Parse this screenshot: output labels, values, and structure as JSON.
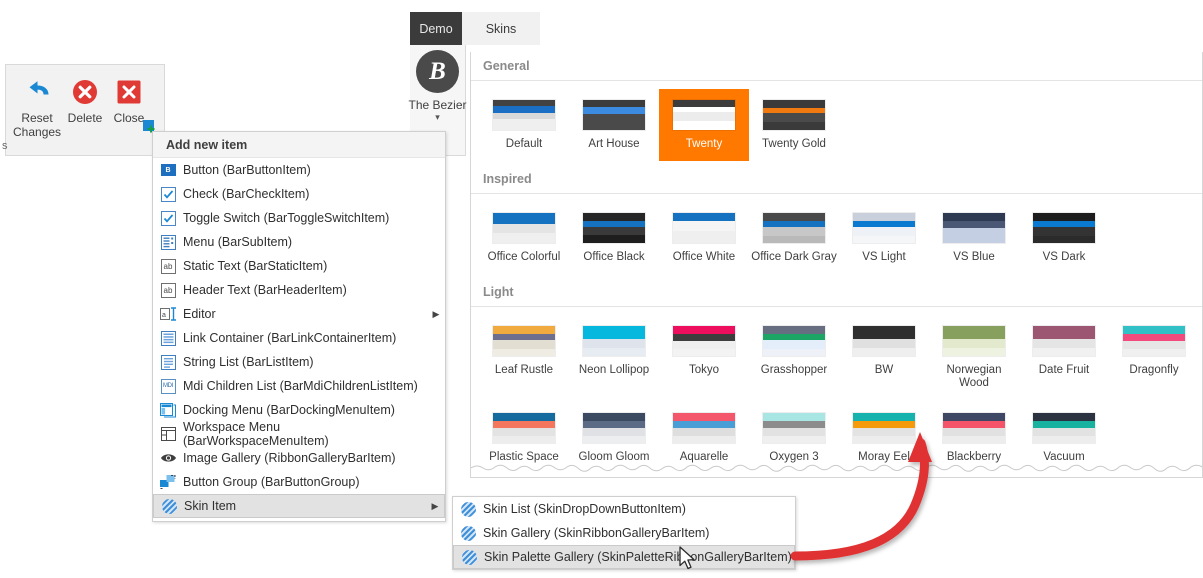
{
  "ribbon": {
    "tabs": [
      {
        "label": "Demo",
        "active": false
      },
      {
        "label": "Skins",
        "active": true
      }
    ],
    "group": {
      "icon": "bezier-circle-icon",
      "glyph": "B",
      "label": "The Bezier",
      "caret": "▾"
    }
  },
  "gallery": {
    "groups": [
      {
        "title": "General",
        "items": [
          {
            "name": "Default",
            "selected": false,
            "bands": [
              {
                "c": "#424242",
                "h": 6
              },
              {
                "c": "#1a6fc4",
                "h": 7
              },
              {
                "c": "#d9d9d9",
                "h": 6
              },
              {
                "c": "#efefef",
                "h": 11
              }
            ]
          },
          {
            "name": "Art House",
            "selected": false,
            "bands": [
              {
                "c": "#3c3c3c",
                "h": 7
              },
              {
                "c": "#3b8ce0",
                "h": 7
              },
              {
                "c": "#4a4a4a",
                "h": 9
              },
              {
                "c": "#4a4a4a",
                "h": 7
              }
            ]
          },
          {
            "name": "Twenty",
            "selected": true,
            "bands": [
              {
                "c": "#3c3c3c",
                "h": 7
              },
              {
                "c": "#ffffff",
                "h": 5
              },
              {
                "c": "#ececec",
                "h": 9
              },
              {
                "c": "#ffffff",
                "h": 9
              }
            ]
          },
          {
            "name": "Twenty Gold",
            "selected": false,
            "bands": [
              {
                "c": "#3a3a3a",
                "h": 8
              },
              {
                "c": "#f07a10",
                "h": 5
              },
              {
                "c": "#4a4a4a",
                "h": 9
              },
              {
                "c": "#3a3a3a",
                "h": 8
              }
            ]
          }
        ]
      },
      {
        "title": "Inspired",
        "items": [
          {
            "name": "Office Colorful",
            "selected": false,
            "bands": [
              {
                "c": "#1572c0",
                "h": 11
              },
              {
                "c": "#e4e4e4",
                "h": 9
              },
              {
                "c": "#efefef",
                "h": 10
              }
            ]
          },
          {
            "name": "Office Black",
            "selected": false,
            "bands": [
              {
                "c": "#262626",
                "h": 8
              },
              {
                "c": "#1572c0",
                "h": 6
              },
              {
                "c": "#3a3a3a",
                "h": 8
              },
              {
                "c": "#1e1e1e",
                "h": 8
              }
            ]
          },
          {
            "name": "Office White",
            "selected": false,
            "bands": [
              {
                "c": "#1572c0",
                "h": 8
              },
              {
                "c": "#f5f5f5",
                "h": 10
              },
              {
                "c": "#efefef",
                "h": 12
              }
            ]
          },
          {
            "name": "Office Dark Gray",
            "selected": false,
            "bands": [
              {
                "c": "#4a4a4a",
                "h": 8
              },
              {
                "c": "#1572c0",
                "h": 6
              },
              {
                "c": "#c7c7c7",
                "h": 9
              },
              {
                "c": "#b9b9b9",
                "h": 7
              }
            ]
          },
          {
            "name": "VS Light",
            "selected": false,
            "bands": [
              {
                "c": "#c9d0dc",
                "h": 8
              },
              {
                "c": "#0a7ad0",
                "h": 6
              },
              {
                "c": "#eef1f5",
                "h": 9
              },
              {
                "c": "#f4f6f8",
                "h": 7
              }
            ]
          },
          {
            "name": "VS Blue",
            "selected": false,
            "bands": [
              {
                "c": "#2e3a52",
                "h": 8
              },
              {
                "c": "#4a5875",
                "h": 7
              },
              {
                "c": "#c5cfe3",
                "h": 9
              },
              {
                "c": "#c5cfe3",
                "h": 6
              }
            ]
          },
          {
            "name": "VS Dark",
            "selected": false,
            "bands": [
              {
                "c": "#1d1d1d",
                "h": 8
              },
              {
                "c": "#0a7ad0",
                "h": 6
              },
              {
                "c": "#333333",
                "h": 9
              },
              {
                "c": "#2b2b2b",
                "h": 7
              }
            ]
          }
        ]
      },
      {
        "title": "Light",
        "items": [
          {
            "name": "Leaf Rustle",
            "selected": false,
            "bands": [
              {
                "c": "#f0aa3e",
                "h": 8
              },
              {
                "c": "#6e6f8e",
                "h": 6
              },
              {
                "c": "#e3ded2",
                "h": 9
              },
              {
                "c": "#efece4",
                "h": 7
              }
            ]
          },
          {
            "name": "Neon Lollipop",
            "selected": false,
            "bands": [
              {
                "c": "#07b8de",
                "h": 13
              },
              {
                "c": "#dfe3ec",
                "h": 9
              },
              {
                "c": "#e7ebf2",
                "h": 8
              }
            ]
          },
          {
            "name": "Tokyo",
            "selected": false,
            "bands": [
              {
                "c": "#ed0f5d",
                "h": 8
              },
              {
                "c": "#3d3d3d",
                "h": 7
              },
              {
                "c": "#efefef",
                "h": 8
              },
              {
                "c": "#f3f3f3",
                "h": 7
              }
            ]
          },
          {
            "name": "Grasshopper",
            "selected": false,
            "bands": [
              {
                "c": "#686e82",
                "h": 8
              },
              {
                "c": "#1da565",
                "h": 6
              },
              {
                "c": "#e4edfa",
                "h": 9
              },
              {
                "c": "#eef2f8",
                "h": 7
              }
            ]
          },
          {
            "name": "BW",
            "selected": false,
            "bands": [
              {
                "c": "#2f2f2f",
                "h": 13
              },
              {
                "c": "#e0e0e0",
                "h": 9
              },
              {
                "c": "#efefef",
                "h": 8
              }
            ]
          },
          {
            "name": "Norwegian Wood",
            "selected": false,
            "bands": [
              {
                "c": "#87a05e",
                "h": 13
              },
              {
                "c": "#e3e9cd",
                "h": 9
              },
              {
                "c": "#eef2e0",
                "h": 8
              }
            ]
          },
          {
            "name": "Date Fruit",
            "selected": false,
            "bands": [
              {
                "c": "#9d5672",
                "h": 13
              },
              {
                "c": "#e5e5e5",
                "h": 9
              },
              {
                "c": "#f1f1f1",
                "h": 8
              }
            ]
          },
          {
            "name": "Dragonfly",
            "selected": false,
            "bands": [
              {
                "c": "#31c0c6",
                "h": 8
              },
              {
                "c": "#f34a7d",
                "h": 7
              },
              {
                "c": "#e6e6e6",
                "h": 8
              },
              {
                "c": "#f0f0f0",
                "h": 7
              }
            ]
          },
          {
            "name": "Plastic Space",
            "selected": false,
            "bands": [
              {
                "c": "#156a9e",
                "h": 8
              },
              {
                "c": "#f4775d",
                "h": 7
              },
              {
                "c": "#e3e3e3",
                "h": 8
              },
              {
                "c": "#ededed",
                "h": 7
              }
            ]
          },
          {
            "name": "Gloom Gloom",
            "selected": false,
            "bands": [
              {
                "c": "#3b4a60",
                "h": 8
              },
              {
                "c": "#5b6a85",
                "h": 7
              },
              {
                "c": "#dfe1e5",
                "h": 8
              },
              {
                "c": "#eceef0",
                "h": 7
              }
            ]
          },
          {
            "name": "Aquarelle",
            "selected": false,
            "bands": [
              {
                "c": "#f4566b",
                "h": 8
              },
              {
                "c": "#4a9ed6",
                "h": 7
              },
              {
                "c": "#dedede",
                "h": 8
              },
              {
                "c": "#ededed",
                "h": 7
              }
            ]
          },
          {
            "name": "Oxygen 3",
            "selected": false,
            "bands": [
              {
                "c": "#a7e6e2",
                "h": 8
              },
              {
                "c": "#8c8c8c",
                "h": 7
              },
              {
                "c": "#e2e2e2",
                "h": 8
              },
              {
                "c": "#efefef",
                "h": 7
              }
            ]
          },
          {
            "name": "Moray Eel",
            "selected": false,
            "bands": [
              {
                "c": "#16b2ad",
                "h": 8
              },
              {
                "c": "#f59a0a",
                "h": 7
              },
              {
                "c": "#e3e3e3",
                "h": 8
              },
              {
                "c": "#ededed",
                "h": 7
              }
            ]
          },
          {
            "name": "Blackberry",
            "selected": false,
            "bands": [
              {
                "c": "#3e4763",
                "h": 8
              },
              {
                "c": "#f4536a",
                "h": 7
              },
              {
                "c": "#e1e1e1",
                "h": 8
              },
              {
                "c": "#ededed",
                "h": 7
              }
            ]
          },
          {
            "name": "Vacuum",
            "selected": false,
            "bands": [
              {
                "c": "#2c3340",
                "h": 8
              },
              {
                "c": "#18b3a0",
                "h": 7
              },
              {
                "c": "#e2e2e2",
                "h": 8
              },
              {
                "c": "#ededed",
                "h": 7
              }
            ]
          }
        ]
      }
    ]
  },
  "mini_toolbar": {
    "buttons": [
      {
        "label": "Reset Changes",
        "icon": "undo-arrow-icon"
      },
      {
        "label": "Delete",
        "icon": "delete-circle-x-icon"
      },
      {
        "label": "Close",
        "icon": "close-square-x-icon"
      }
    ],
    "edge_text": "s",
    "badge_icon": "add-item-badge-icon"
  },
  "add_menu": {
    "title": "Add new item",
    "items": [
      {
        "label": "Button (BarButtonItem)",
        "icon": "button-icon",
        "arrow": false,
        "highlight": false
      },
      {
        "label": "Check (BarCheckItem)",
        "icon": "checkbox-icon",
        "arrow": false,
        "highlight": false
      },
      {
        "label": "Toggle Switch (BarToggleSwitchItem)",
        "icon": "checkbox-icon",
        "arrow": false,
        "highlight": false
      },
      {
        "label": "Menu (BarSubItem)",
        "icon": "menu-list-icon",
        "arrow": false,
        "highlight": false
      },
      {
        "label": "Static Text (BarStaticItem)",
        "icon": "ab-text-icon",
        "arrow": false,
        "highlight": false
      },
      {
        "label": "Header Text (BarHeaderItem)",
        "icon": "ab-text-icon",
        "arrow": false,
        "highlight": false
      },
      {
        "label": "Editor",
        "icon": "editor-caret-icon",
        "arrow": true,
        "highlight": false
      },
      {
        "label": "Link Container (BarLinkContainerItem)",
        "icon": "link-container-icon",
        "arrow": false,
        "highlight": false
      },
      {
        "label": "String List (BarListItem)",
        "icon": "list-lines-icon",
        "arrow": false,
        "highlight": false
      },
      {
        "label": "Mdi Children List (BarMdiChildrenListItem)",
        "icon": "mdi-icon",
        "arrow": false,
        "highlight": false
      },
      {
        "label": "Docking Menu (BarDockingMenuItem)",
        "icon": "docking-panel-icon",
        "arrow": false,
        "highlight": false
      },
      {
        "label": "Workspace Menu (BarWorkspaceMenuItem)",
        "icon": "workspace-icon",
        "arrow": false,
        "highlight": false
      },
      {
        "label": "Image Gallery (RibbonGalleryBarItem)",
        "icon": "eye-icon",
        "arrow": false,
        "highlight": false
      },
      {
        "label": "Button Group (BarButtonGroup)",
        "icon": "button-group-icon",
        "arrow": false,
        "highlight": false
      },
      {
        "label": "Skin Item",
        "icon": "skin-stripes-icon",
        "arrow": true,
        "highlight": true
      }
    ],
    "arrow_glyph": "▶"
  },
  "sub_menu": {
    "items": [
      {
        "label": "Skin List (SkinDropDownButtonItem)",
        "icon": "skin-stripes-icon",
        "highlight": false
      },
      {
        "label": "Skin Gallery (SkinRibbonGalleryBarItem)",
        "icon": "skin-stripes-icon",
        "highlight": false
      },
      {
        "label": "Skin Palette Gallery (SkinPaletteRibbonGalleryBarItem)",
        "icon": "skin-stripes-icon",
        "highlight": true
      }
    ]
  },
  "annotation": {
    "arrow_color": "#e03131",
    "cursor_icon": "mouse-pointer-icon"
  }
}
